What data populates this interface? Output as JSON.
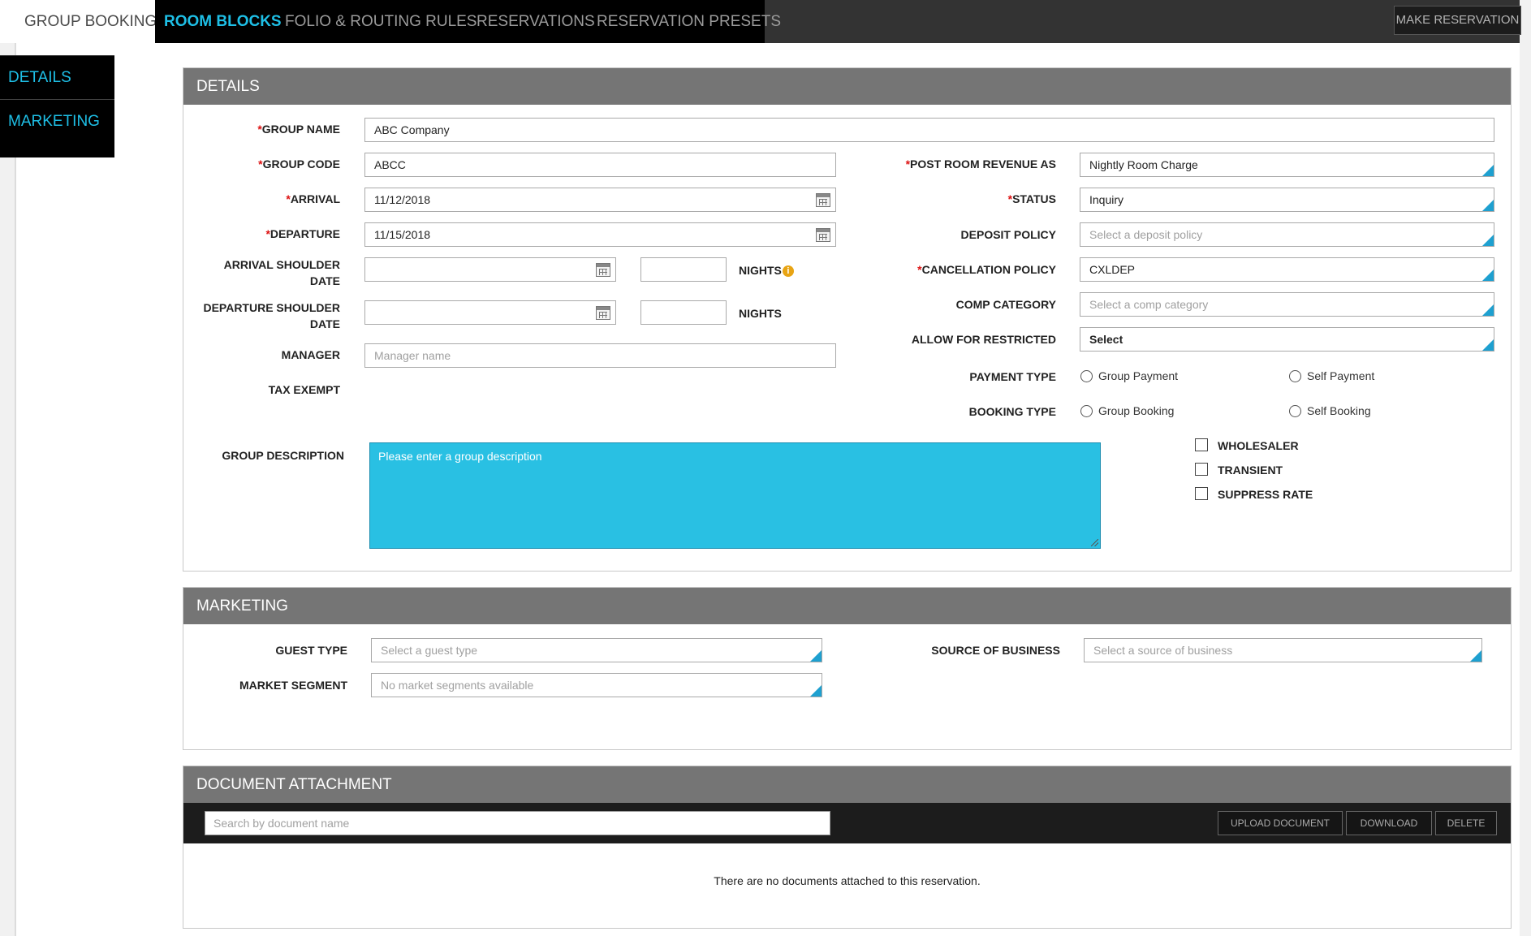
{
  "topnav": {
    "tabs": [
      "GROUP BOOKING",
      "ROOM BLOCKS",
      "FOLIO & ROUTING RULES",
      "RESERVATIONS",
      "RESERVATION PRESETS"
    ],
    "make_reservation": "MAKE RESERVATION"
  },
  "sidenav": {
    "items": [
      "DETAILS",
      "MARKETING"
    ]
  },
  "details": {
    "title": "DETAILS",
    "group_name": {
      "label": "GROUP NAME",
      "value": "ABC Company"
    },
    "group_code": {
      "label": "GROUP CODE",
      "value": "ABCC"
    },
    "arrival": {
      "label": "ARRIVAL",
      "value": "11/12/2018"
    },
    "departure": {
      "label": "DEPARTURE",
      "value": "11/15/2018"
    },
    "arrival_shoulder": {
      "label_1": "ARRIVAL SHOULDER",
      "label_2": "DATE",
      "value": "",
      "nights_value": "",
      "nights_label": "NIGHTS"
    },
    "departure_shoulder": {
      "label_1": "DEPARTURE SHOULDER",
      "label_2": "DATE",
      "value": "",
      "nights_value": "",
      "nights_label": "NIGHTS"
    },
    "manager": {
      "label": "MANAGER",
      "placeholder": "Manager name"
    },
    "tax_exempt": {
      "label": "TAX EXEMPT"
    },
    "post_room_revenue": {
      "label": "POST ROOM REVENUE AS",
      "value": "Nightly Room Charge"
    },
    "status": {
      "label": "STATUS",
      "value": "Inquiry"
    },
    "deposit_policy": {
      "label": "DEPOSIT POLICY",
      "placeholder": "Select a deposit policy"
    },
    "cancellation_policy": {
      "label": "CANCELLATION POLICY",
      "value": "CXLDEP"
    },
    "comp_category": {
      "label": "COMP CATEGORY",
      "placeholder": "Select a comp category"
    },
    "allow_restricted": {
      "label": "ALLOW FOR RESTRICTED",
      "value": "Select"
    },
    "payment_type": {
      "label": "PAYMENT TYPE",
      "options": [
        "Group Payment",
        "Self Payment"
      ]
    },
    "booking_type": {
      "label": "BOOKING TYPE",
      "options": [
        "Group Booking",
        "Self Booking"
      ]
    },
    "group_description": {
      "label": "GROUP DESCRIPTION",
      "placeholder": "Please enter a group description"
    },
    "checkboxes": [
      "WHOLESALER",
      "TRANSIENT",
      "SUPPRESS RATE"
    ],
    "required_mark": "*"
  },
  "marketing": {
    "title": "MARKETING",
    "guest_type": {
      "label": "GUEST TYPE",
      "placeholder": "Select a guest type"
    },
    "market_segment": {
      "label": "MARKET SEGMENT",
      "placeholder": "No market segments available"
    },
    "source_of_business": {
      "label": "SOURCE OF BUSINESS",
      "placeholder": "Select a source of business"
    }
  },
  "documents": {
    "title": "DOCUMENT ATTACHMENT",
    "search_placeholder": "Search by document name",
    "buttons": [
      "UPLOAD DOCUMENT",
      "DOWNLOAD",
      "DELETE"
    ],
    "empty_text": "There are no documents attached to this reservation."
  },
  "icons": {
    "calendar": "calendar-icon",
    "info": "info-icon",
    "info_glyph": "i"
  },
  "colors": {
    "accent": "#1ebfe6",
    "textarea": "#29c0e3",
    "required": "#dd1111",
    "warning": "#e8a414"
  }
}
